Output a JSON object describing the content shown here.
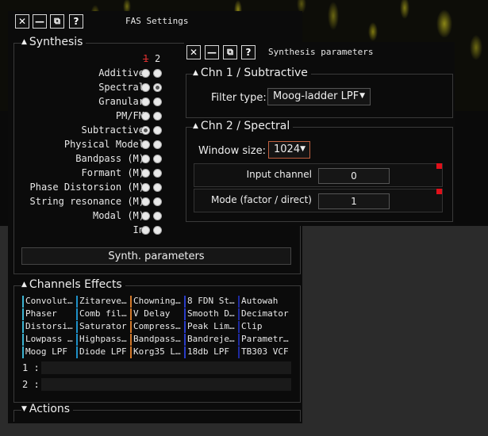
{
  "fas_window": {
    "title": "FAS Settings",
    "synthesis": {
      "header": "Synthesis",
      "col1": "1",
      "col2": "2",
      "rows": [
        {
          "label": "Additive",
          "sel": [
            false,
            false
          ]
        },
        {
          "label": "Spectral",
          "sel": [
            false,
            true
          ]
        },
        {
          "label": "Granular",
          "sel": [
            false,
            false
          ]
        },
        {
          "label": "PM/FM",
          "sel": [
            false,
            false
          ]
        },
        {
          "label": "Subtractive",
          "sel": [
            true,
            false
          ]
        },
        {
          "label": "Physical Model",
          "sel": [
            false,
            false
          ]
        },
        {
          "label": "Bandpass (M)",
          "sel": [
            false,
            false
          ]
        },
        {
          "label": "Formant (M)",
          "sel": [
            false,
            false
          ]
        },
        {
          "label": "Phase Distorsion (M)",
          "sel": [
            false,
            false
          ]
        },
        {
          "label": "String resonance (M)",
          "sel": [
            false,
            false
          ]
        },
        {
          "label": "Modal (M)",
          "sel": [
            false,
            false
          ]
        },
        {
          "label": "In",
          "sel": [
            false,
            false
          ]
        }
      ],
      "params_button": "Synth. parameters"
    },
    "effects": {
      "header": "Channels Effects",
      "columns": [
        {
          "color": "#3cb4d2",
          "items": [
            "Convolut…",
            "Phaser",
            "Distorsi…",
            "Lowpass …",
            "Moog LPF"
          ]
        },
        {
          "color": "#1e90c8",
          "items": [
            "Zitareve…",
            "Comb fil…",
            "Saturator",
            "Highpass…",
            "Diode LPF"
          ]
        },
        {
          "color": "#d2782a",
          "items": [
            "Chowning…",
            "V Delay",
            "Compress…",
            "Bandpass…",
            "Korg35 L…"
          ]
        },
        {
          "color": "#2a3cc8",
          "items": [
            "8 FDN St…",
            "Smooth D…",
            "Peak Lim…",
            "Bandreje…",
            "18db LPF"
          ]
        },
        {
          "color": "#1e2aa0",
          "items": [
            "Autowah",
            "Decimator",
            "Clip",
            "Parametr…",
            "TB303 VCF"
          ]
        }
      ],
      "channels": [
        {
          "label": "1 :"
        },
        {
          "label": "2 :"
        }
      ]
    },
    "actions": {
      "header": "Actions"
    }
  },
  "synth_window": {
    "title": "Synthesis parameters",
    "chn1": {
      "header": "Chn 1 / Subtractive",
      "filter_label": "Filter type:",
      "filter_value": "Moog-ladder LPF",
      "arrow": "▼"
    },
    "chn2": {
      "header": "Chn 2 / Spectral",
      "window_label": "Window size:",
      "window_value": "1024",
      "arrow": "▼",
      "params": [
        {
          "label": "Input channel",
          "value": "0"
        },
        {
          "label": "Mode (factor / direct)",
          "value": "1"
        }
      ]
    }
  },
  "buttons": {
    "close": "✕",
    "minimize": "—",
    "restore": "⧉",
    "help": "?"
  },
  "colors": {
    "accent_red": "#e0101a",
    "window_bg": "#0b0b0b",
    "border": "#3a3a3a"
  }
}
